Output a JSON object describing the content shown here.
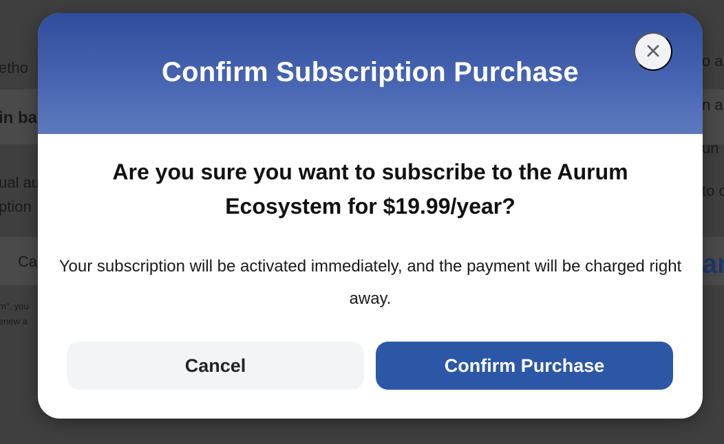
{
  "background": {
    "fragments": [
      "etho",
      "in ba",
      "ual au",
      "ption",
      "Ca",
      "m\", you",
      "enew a",
      "o al",
      "n a",
      "un",
      "to c",
      "an"
    ]
  },
  "modal": {
    "title": "Confirm Subscription Purchase",
    "close_icon": "close-icon",
    "question": "Are you sure you want to subscribe to the Aurum Ecosystem for $19.99/year?",
    "note": "Your subscription will be activated immediately, and the payment will be charged right away.",
    "cancel_label": "Cancel",
    "confirm_label": "Confirm Purchase"
  },
  "colors": {
    "header_top": "#2f4d9c",
    "header_bottom": "#5d79bd",
    "confirm_button": "#2b57a6",
    "cancel_button": "#f3f4f6",
    "backdrop": "#3f3f40"
  }
}
